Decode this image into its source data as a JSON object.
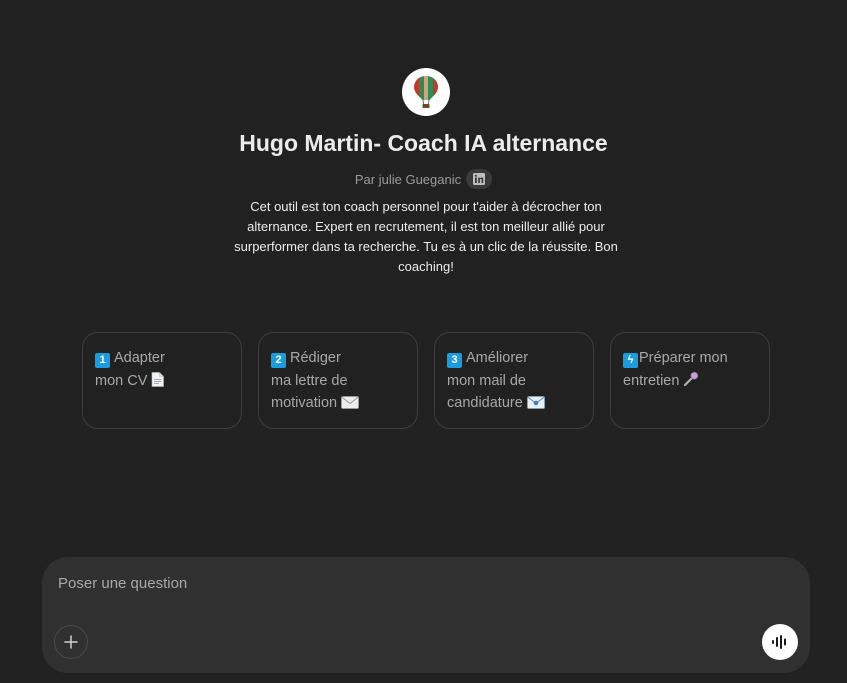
{
  "gpt": {
    "avatar_icon": "hot-air-balloon-icon",
    "title": "Hugo Martin- Coach IA alternance",
    "byline": "Par julie Gueganic",
    "byline_icon": "linkedin-icon",
    "description": "Cet outil est ton coach personnel pour t'aider à décrocher ton alternance. Expert en recrutement, il est ton meilleur allié pour surperformer dans ta recherche. Tu es à un clic de la réussite. Bon coaching!"
  },
  "starters": [
    {
      "badge": "1",
      "line1": "Adapter",
      "line2": "mon CV",
      "line3": "",
      "icon": "document-icon"
    },
    {
      "badge": "2",
      "line1": "Rédiger",
      "line2": "ma lettre de",
      "line3": "motivation",
      "icon": "envelope-icon"
    },
    {
      "badge": "3",
      "line1": "Améliorer",
      "line2": "mon mail de",
      "line3": "candidature",
      "icon": "email-incoming-icon"
    },
    {
      "badge": "ϟ",
      "line1": "Préparer mon",
      "line2": "entretien",
      "line3": "",
      "icon": "microphone-icon"
    }
  ],
  "composer": {
    "placeholder": "Poser une question",
    "add_icon": "plus-icon",
    "voice_icon": "voice-waveform-icon"
  },
  "colors": {
    "background": "#212121",
    "composer_bg": "#303030",
    "keycap_blue": "#1a9ce0",
    "card_border": "#3d3d3d"
  }
}
